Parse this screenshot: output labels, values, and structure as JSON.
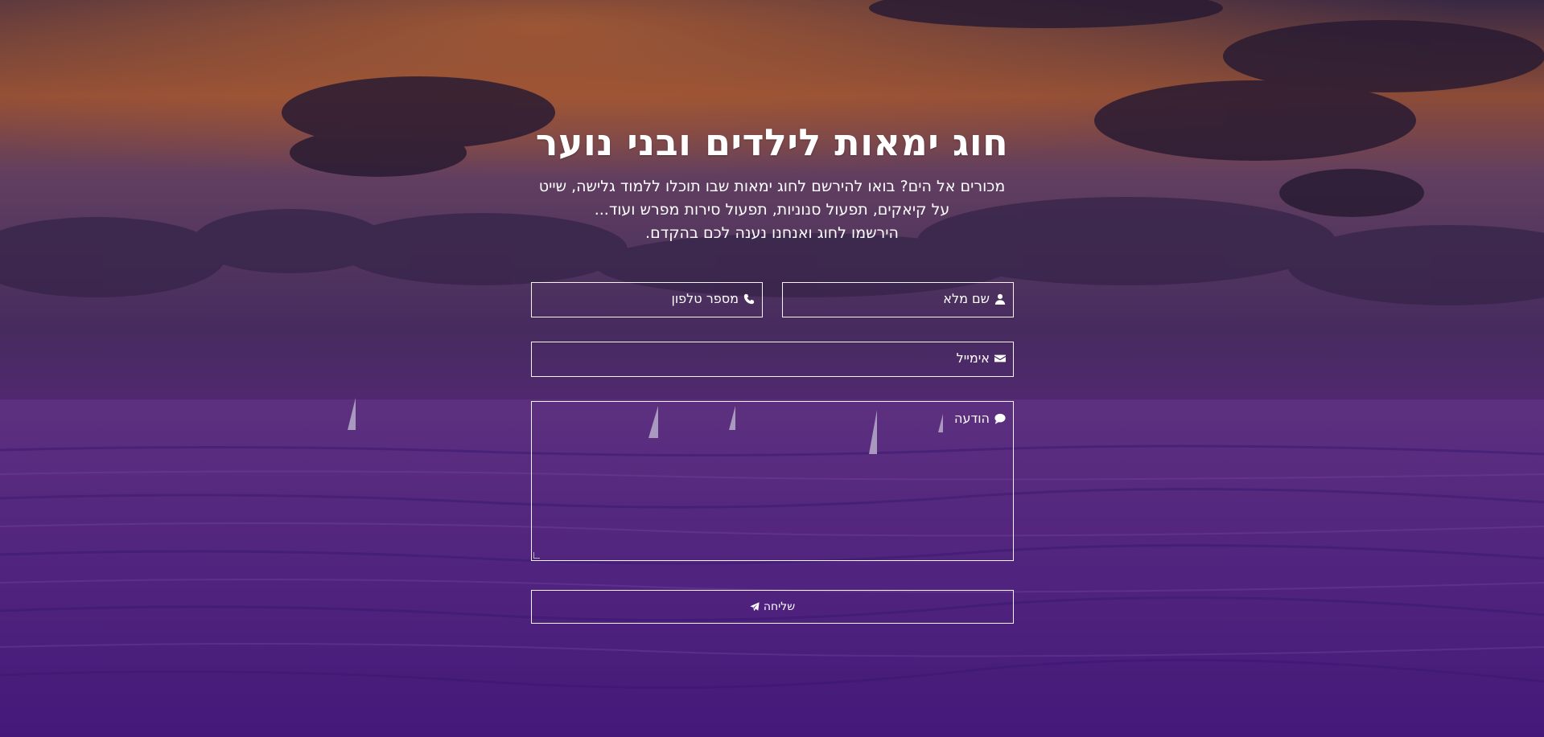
{
  "hero": {
    "title": "חוג ימאות לילדים ובני נוער",
    "lead_line1": "מכורים אל הים? בואו להירשם לחוג ימאות שבו תוכלו ללמוד גלישה, שייט",
    "lead_line2": "על קיאקים, תפעול סנוניות, תפעול סירות מפרש ועוד...",
    "lead_line3": "הירשמו לחוג ואנחנו נענה לכם בהקדם."
  },
  "form": {
    "name_label": "שם מלא",
    "name_icon": "user-icon",
    "phone_label": "מספר טלפון",
    "phone_icon": "phone-icon",
    "email_label": "אימייל",
    "email_icon": "envelope-icon",
    "message_label": "הודעה",
    "message_icon": "comment-icon",
    "submit_label": "שליחה",
    "submit_icon": "paper-plane-icon"
  },
  "colors": {
    "text": "#ffffff",
    "field_border": "#ffffff",
    "sky_orange": "#a35a34",
    "sea_purple": "#5e2c8e"
  }
}
